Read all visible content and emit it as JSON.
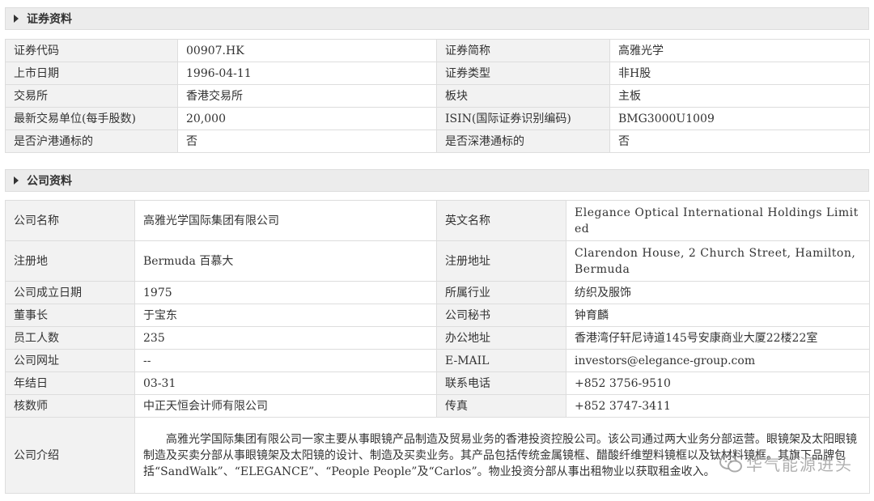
{
  "securities": {
    "title": "证券资料",
    "rows": [
      [
        "证券代码",
        "00907.HK",
        "证券简称",
        "高雅光学"
      ],
      [
        "上市日期",
        "1996-04-11",
        "证券类型",
        "非H股"
      ],
      [
        "交易所",
        "香港交易所",
        "板块",
        "主板"
      ],
      [
        "最新交易单位(每手股数)",
        "20,000",
        "ISIN(国际证券识别编码)",
        "BMG3000U1009"
      ],
      [
        "是否沪港通标的",
        "否",
        "是否深港通标的",
        "否"
      ]
    ]
  },
  "company": {
    "title": "公司资料",
    "rows": [
      [
        "公司名称",
        "高雅光学国际集团有限公司",
        "英文名称",
        "Elegance Optical International Holdings Limited"
      ],
      [
        "注册地",
        "Bermuda 百慕大",
        "注册地址",
        "Clarendon House, 2 Church Street, Hamilton, Bermuda"
      ],
      [
        "公司成立日期",
        "1975",
        "所属行业",
        "纺织及服饰"
      ],
      [
        "董事长",
        "于宝东",
        "公司秘书",
        "钟育麟"
      ],
      [
        "员工人数",
        "235",
        "办公地址",
        "香港湾仔轩尼诗道145号安康商业大厦22楼22室"
      ],
      [
        "公司网址",
        "--",
        "E-MAIL",
        "investors@elegance-group.com"
      ],
      [
        "年结日",
        "03-31",
        "联系电话",
        "+852 3756-9510"
      ],
      [
        "核数师",
        "中正天恒会计师有限公司",
        "传真",
        "+852 3747-3411"
      ]
    ],
    "intro_label": "公司介绍",
    "intro_text": "高雅光学国际集团有限公司一家主要从事眼镜产品制造及贸易业务的香港投资控股公司。该公司通过两大业务分部运营。眼镜架及太阳眼镜制造及买卖分部从事眼镜架及太阳镜的设计、制造及买卖业务。其产品包括传统金属镜框、醋酸纤维塑料镜框以及钛材料镜框。其旗下品牌包括“SandWalk”、“ELEGANCE”、“People People”及“Carlos”。物业投资分部从事出租物业以获取租金收入。"
  },
  "watermark": {
    "text": "华气能源进头"
  }
}
